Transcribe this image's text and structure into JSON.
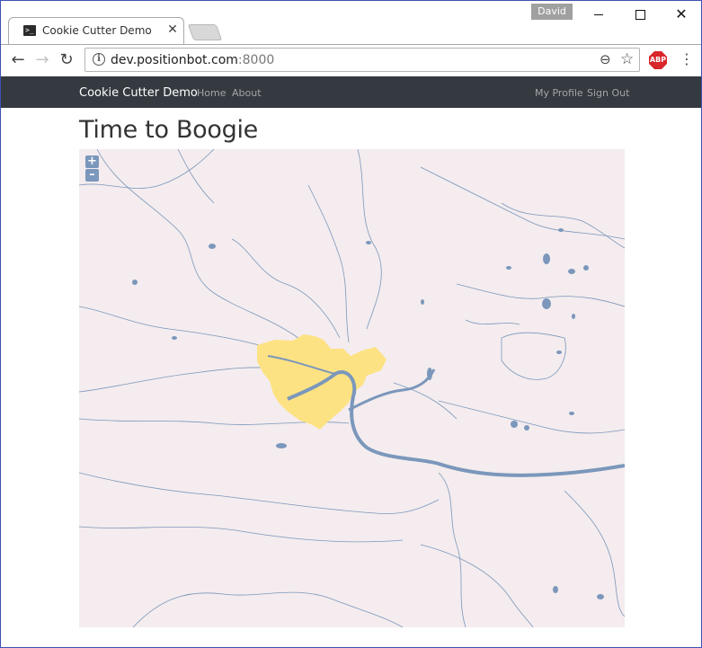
{
  "browser": {
    "tab_title": "Cookie Cutter Demo",
    "tab_close_glyph": "✕",
    "user_name": "David",
    "url_host": "dev.positionbot.com",
    "url_port": ":8000",
    "abp_label": "ABP",
    "info_glyph": "i",
    "back_glyph": "←",
    "forward_glyph": "→",
    "reload_glyph": "↻",
    "zoom_glyph": "⊖",
    "star_glyph": "☆",
    "menu_glyph": "⋮",
    "window_close_glyph": "✕"
  },
  "navbar": {
    "brand": "Cookie Cutter Demo",
    "links": [
      "Home",
      "About"
    ],
    "right_links": [
      "My Profile",
      "Sign Out"
    ]
  },
  "page": {
    "title": "Time to Boogie"
  },
  "map": {
    "zoom_in_label": "+",
    "zoom_out_label": "–",
    "colors": {
      "land": "#f4ecee",
      "water": "#7b97bb",
      "highlight": "#fde283"
    }
  }
}
